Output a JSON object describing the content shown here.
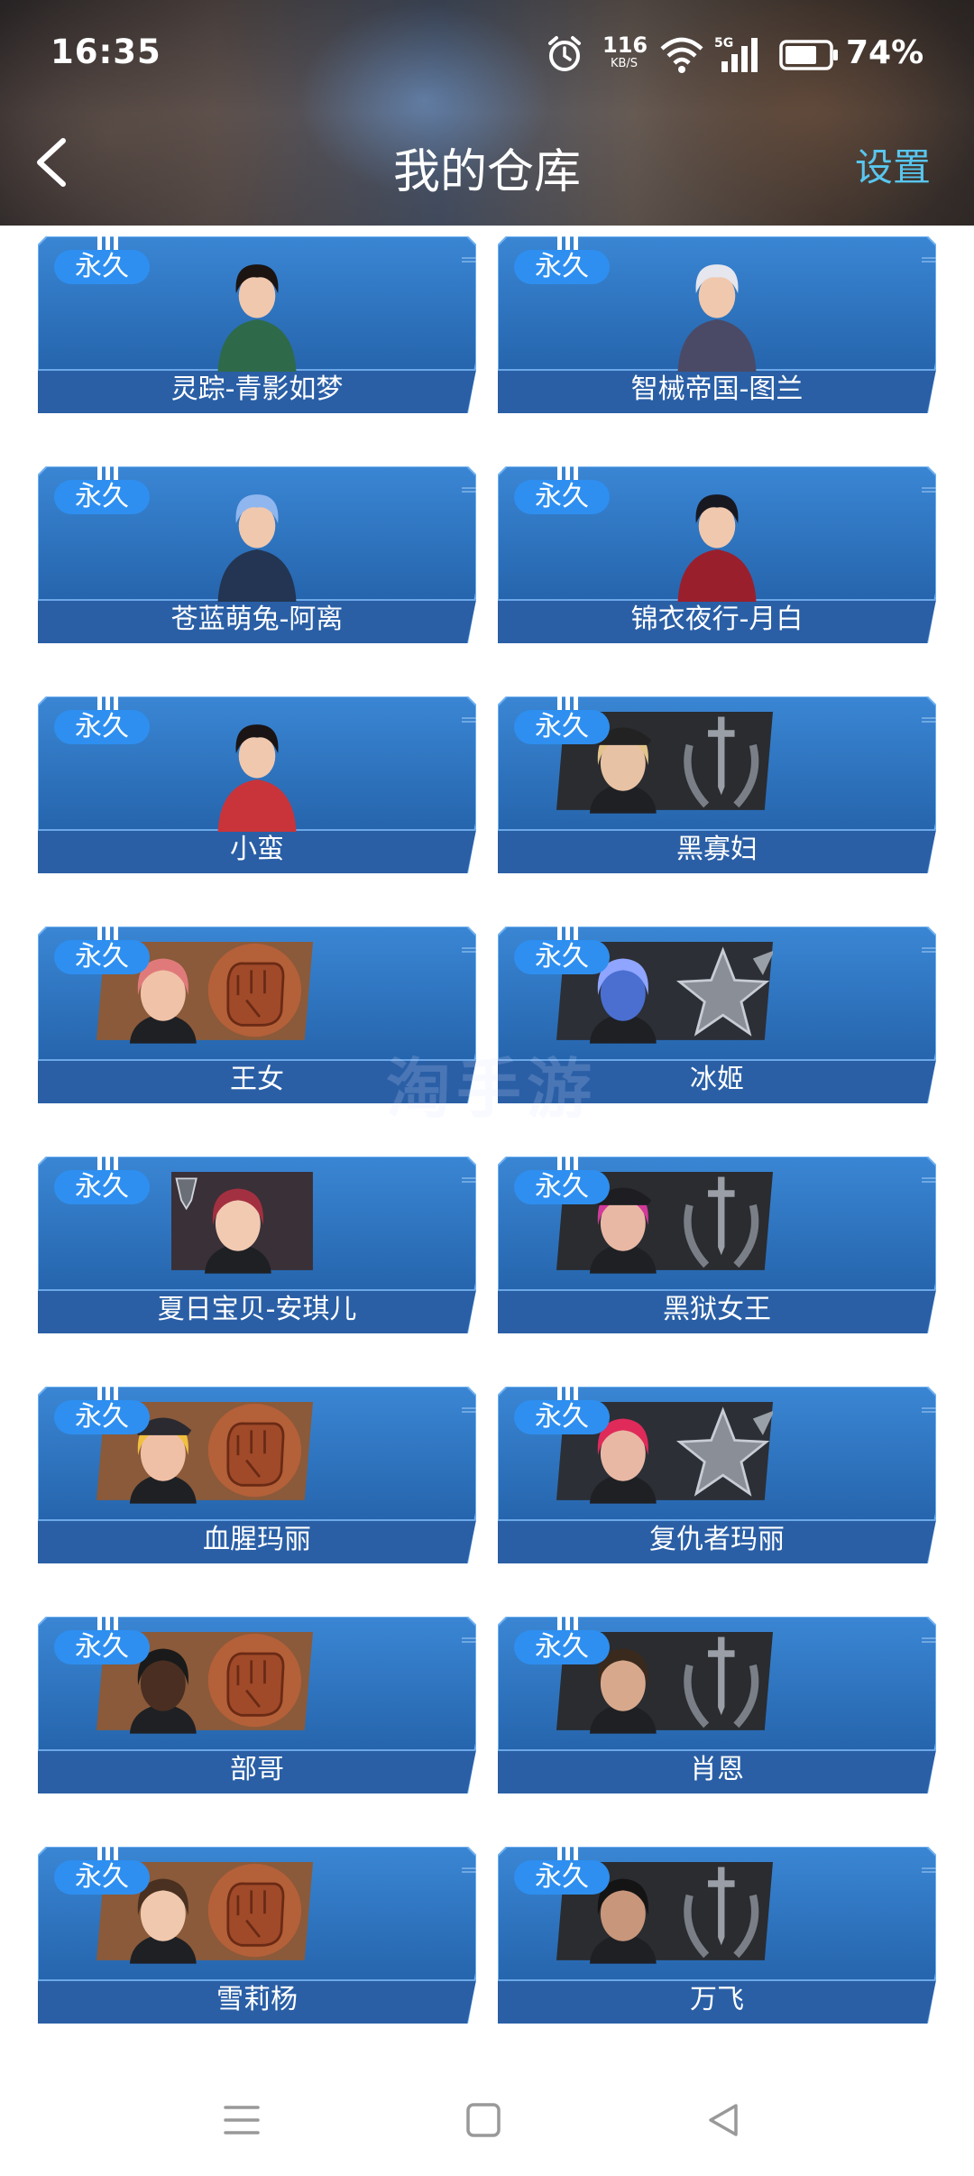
{
  "status_bar": {
    "time": "16:35",
    "net_speed": "116",
    "net_unit": "KB/S",
    "network_type": "5G",
    "battery": "74%"
  },
  "header": {
    "title": "我的仓库",
    "settings_label": "设置"
  },
  "items": [
    {
      "badge": "永久",
      "name": "灵踪-青影如梦",
      "style": "character",
      "hair": "#1b1411",
      "outfit": "#2e6a4a"
    },
    {
      "badge": "永久",
      "name": "智械帝国-图兰",
      "style": "character",
      "hair": "#e6e6ee",
      "outfit": "#4a4a66"
    },
    {
      "badge": "永久",
      "name": "苍蓝萌兔-阿离",
      "style": "character",
      "hair": "#8fb6ef",
      "outfit": "#233552"
    },
    {
      "badge": "永久",
      "name": "锦衣夜行-月白",
      "style": "character",
      "hair": "#181820",
      "outfit": "#9a1f2c"
    },
    {
      "badge": "永久",
      "name": "小蛮",
      "style": "character",
      "hair": "#1a1414",
      "outfit": "#c9343a"
    },
    {
      "badge": "永久",
      "name": "黑寡妇",
      "style": "banner",
      "class_icon": "sword-wreath",
      "banner_bg": "#2a2c30",
      "skin": "#e8c2a4",
      "hair": "#e3c48a",
      "hat": "#222"
    },
    {
      "badge": "永久",
      "name": "王女",
      "style": "banner",
      "class_icon": "fist",
      "banner_bg": "#8a5a3a",
      "skin": "#f0c2a8",
      "hair": "#e07a7a",
      "hat": ""
    },
    {
      "badge": "永久",
      "name": "冰姬",
      "style": "banner",
      "class_icon": "star",
      "banner_bg": "#2c2f36",
      "skin": "#4a6fd0",
      "hair": "#8fa5ff",
      "hat": ""
    },
    {
      "badge": "永久",
      "name": "夏日宝贝-安琪儿",
      "style": "portrait",
      "banner_bg": "#3a3038",
      "skin": "#f2cab2",
      "hair": "#a33040",
      "hat": ""
    },
    {
      "badge": "永久",
      "name": "黑狱女王",
      "style": "banner",
      "class_icon": "sword-wreath",
      "banner_bg": "#2a2c30",
      "skin": "#e8b8a4",
      "hair": "#d23a9a",
      "hat": "#1e1e22"
    },
    {
      "badge": "永久",
      "name": "血腥玛丽",
      "style": "banner",
      "class_icon": "fist",
      "banner_bg": "#8a5a3a",
      "skin": "#f0c0a6",
      "hair": "#f0c040",
      "hat": "#2a2a30"
    },
    {
      "badge": "永久",
      "name": "复仇者玛丽",
      "style": "banner",
      "class_icon": "star",
      "banner_bg": "#2c2f36",
      "skin": "#e8b8a4",
      "hair": "#e02a5a",
      "hat": ""
    },
    {
      "badge": "永久",
      "name": "部哥",
      "style": "banner",
      "class_icon": "fist",
      "banner_bg": "#8a5a3a",
      "skin": "#4a2e22",
      "hair": "#1a1a1a",
      "hat": ""
    },
    {
      "badge": "永久",
      "name": "肖恩",
      "style": "banner",
      "class_icon": "sword-wreath",
      "banner_bg": "#2a2c30",
      "skin": "#d8a88c",
      "hair": "#3a2a1e",
      "hat": ""
    },
    {
      "badge": "永久",
      "name": "雪莉杨",
      "style": "banner",
      "class_icon": "fist",
      "banner_bg": "#8a5a3a",
      "skin": "#f0c8ae",
      "hair": "#4a3020",
      "hat": ""
    },
    {
      "badge": "永久",
      "name": "万飞",
      "style": "banner",
      "class_icon": "sword-wreath",
      "banner_bg": "#2a2c30",
      "skin": "#c8967a",
      "hair": "#141414",
      "hat": ""
    }
  ],
  "watermark": "淘手游",
  "colors": {
    "card_blue": "#2a6cb8",
    "card_blue_dark": "#1f5aa0",
    "badge_blue": "#2e8ff0",
    "settings_cyan": "#58c6ee"
  }
}
